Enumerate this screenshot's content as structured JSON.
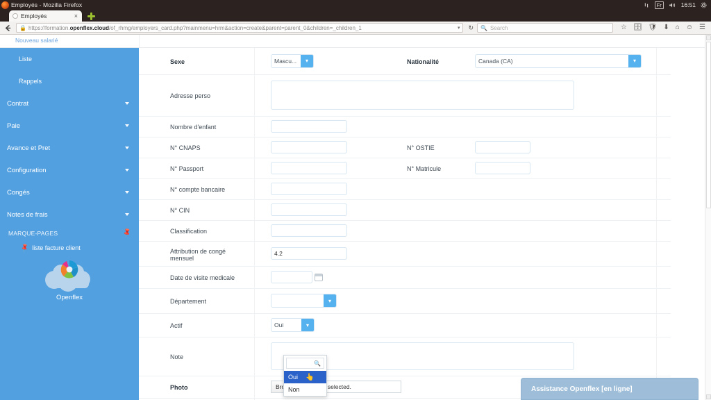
{
  "os": {
    "window_title": "Employés - Mozilla Firefox",
    "tray": {
      "network_icon": "network-icon",
      "keyboard_layout": "Fr",
      "volume_icon": "volume-icon",
      "clock": "16:51",
      "settings_icon": "gear-icon"
    }
  },
  "browser": {
    "tab": {
      "title": "Employés",
      "close_label": "×"
    },
    "new_tab_label": "+",
    "url": {
      "prefix": "https://formation.",
      "domain": "openflex.cloud",
      "path": "/of_rhmg/employers_card.php?mainmenu=hrm&action=create&parent=parent_0&children=_children_1"
    },
    "search_placeholder": "Search",
    "toolbar_icons": [
      "star-icon",
      "pocket-icon",
      "shield-icon",
      "download-icon",
      "home-icon",
      "account-icon",
      "menu-icon"
    ]
  },
  "breadcrumb": {
    "label": "Nouveau salarié"
  },
  "sidebar": {
    "items": [
      {
        "label": "Liste",
        "sub": true,
        "caret": false
      },
      {
        "label": "Rappels",
        "sub": true,
        "caret": false
      },
      {
        "label": "Contrat",
        "sub": false,
        "caret": true
      },
      {
        "label": "Paie",
        "sub": false,
        "caret": true
      },
      {
        "label": "Avance et Pret",
        "sub": false,
        "caret": true
      },
      {
        "label": "Configuration",
        "sub": false,
        "caret": true
      },
      {
        "label": "Congés",
        "sub": false,
        "caret": true
      },
      {
        "label": "Notes de frais",
        "sub": false,
        "caret": true
      }
    ],
    "bookmarks_header": "MARQUE-PAGES",
    "bookmark_link": "liste facture client",
    "brand": "Openflex",
    "accent_color": "#52a0e0"
  },
  "form": {
    "sexe": {
      "label": "Sexe",
      "value": "Mascu..."
    },
    "nationalite": {
      "label": "Nationalité",
      "value": "Canada (CA)"
    },
    "adresse_perso": {
      "label": "Adresse perso",
      "value": ""
    },
    "nombre_enfant": {
      "label": "Nombre d'enfant",
      "value": ""
    },
    "cnaps": {
      "label": "N° CNAPS",
      "value": ""
    },
    "ostie": {
      "label": "N° OSTIE",
      "value": ""
    },
    "passport": {
      "label": "N° Passport",
      "value": ""
    },
    "matricule": {
      "label": "N° Matricule",
      "value": ""
    },
    "compte_bancaire": {
      "label": "N° compte bancaire",
      "value": ""
    },
    "cin": {
      "label": "N° CIN",
      "value": ""
    },
    "classification": {
      "label": "Classification",
      "value": ""
    },
    "attribution_conge": {
      "label_line1": "Attribution de congé",
      "label_line2": "mensuel",
      "value": "4.2"
    },
    "visite_medicale": {
      "label": "Date de visite medicale",
      "value": "",
      "calendar_icon": "calendar-icon"
    },
    "departement": {
      "label": "Département",
      "value": ""
    },
    "actif": {
      "label": "Actif",
      "value": "Oui"
    },
    "note": {
      "label": "Note",
      "value": ""
    },
    "photo": {
      "label": "Photo",
      "browse_label": "Browse...",
      "file_status": "No file selected."
    }
  },
  "dropdown": {
    "search_icon": "search-icon",
    "search_value": "",
    "options": [
      {
        "label": "Oui",
        "selected": true
      },
      {
        "label": "Non",
        "selected": false
      }
    ],
    "highlight_color": "#2a62c9"
  },
  "assistance": {
    "label": "Assistance Openflex [en ligne]"
  }
}
